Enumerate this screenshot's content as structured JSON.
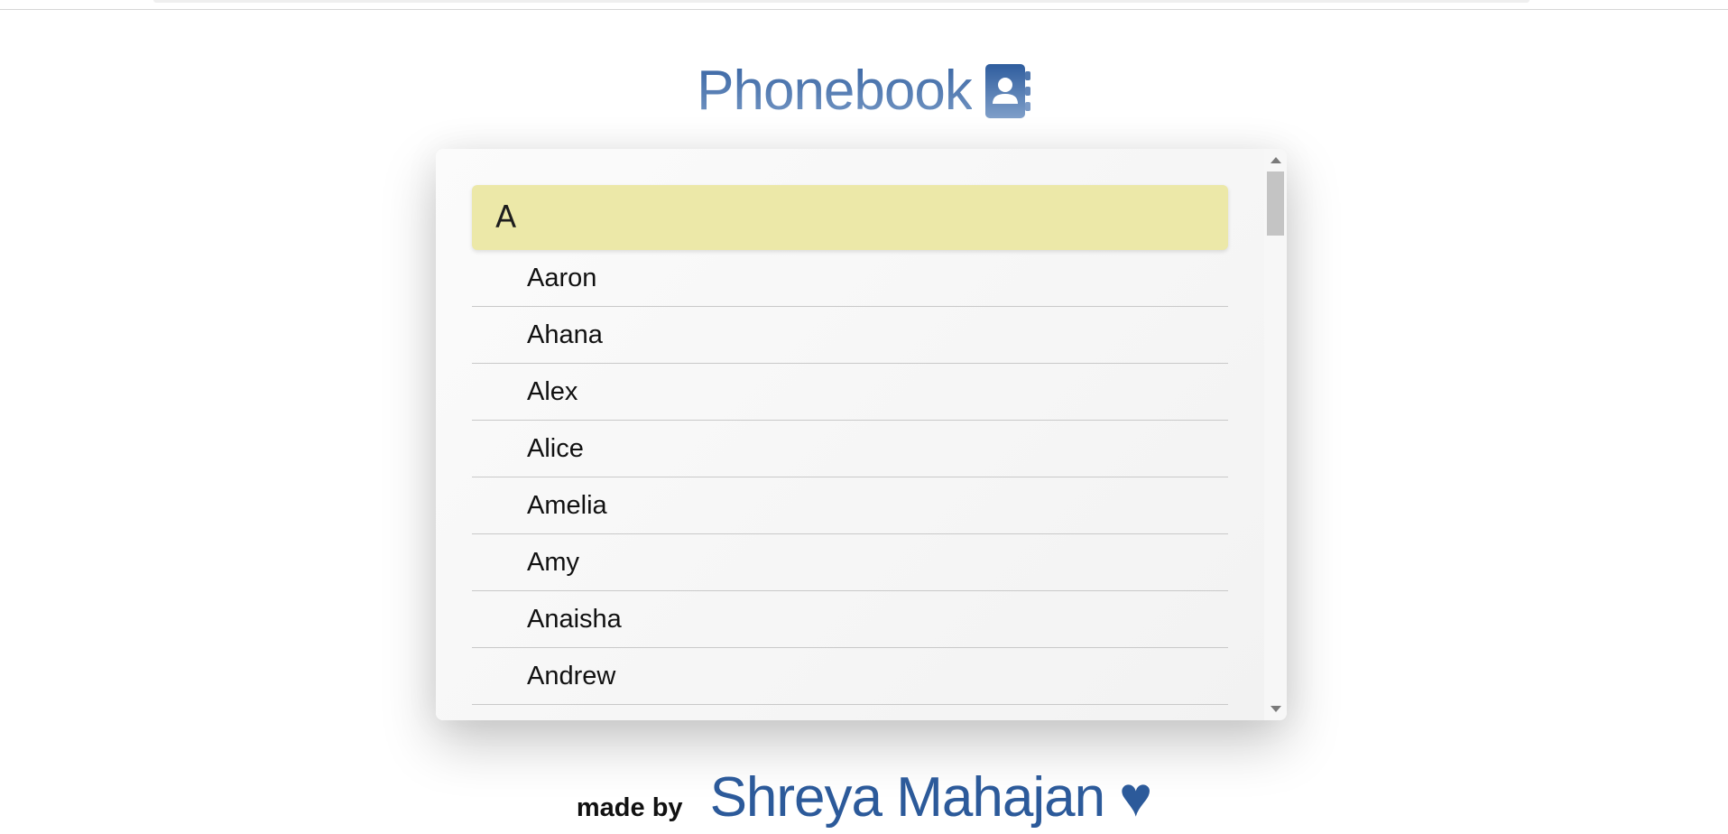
{
  "header": {
    "title": "Phonebook",
    "icon": "contact-book-icon",
    "accent_color": "#2f5d9e"
  },
  "phonebook": {
    "section_letter": "A",
    "section_color": "#ece8a8",
    "contacts": [
      "Aaron",
      "Ahana",
      "Alex",
      "Alice",
      "Amelia",
      "Amy",
      "Anaisha",
      "Andrew"
    ]
  },
  "footer": {
    "made_by": "made by",
    "author": "Shreya Mahajan ♥"
  }
}
